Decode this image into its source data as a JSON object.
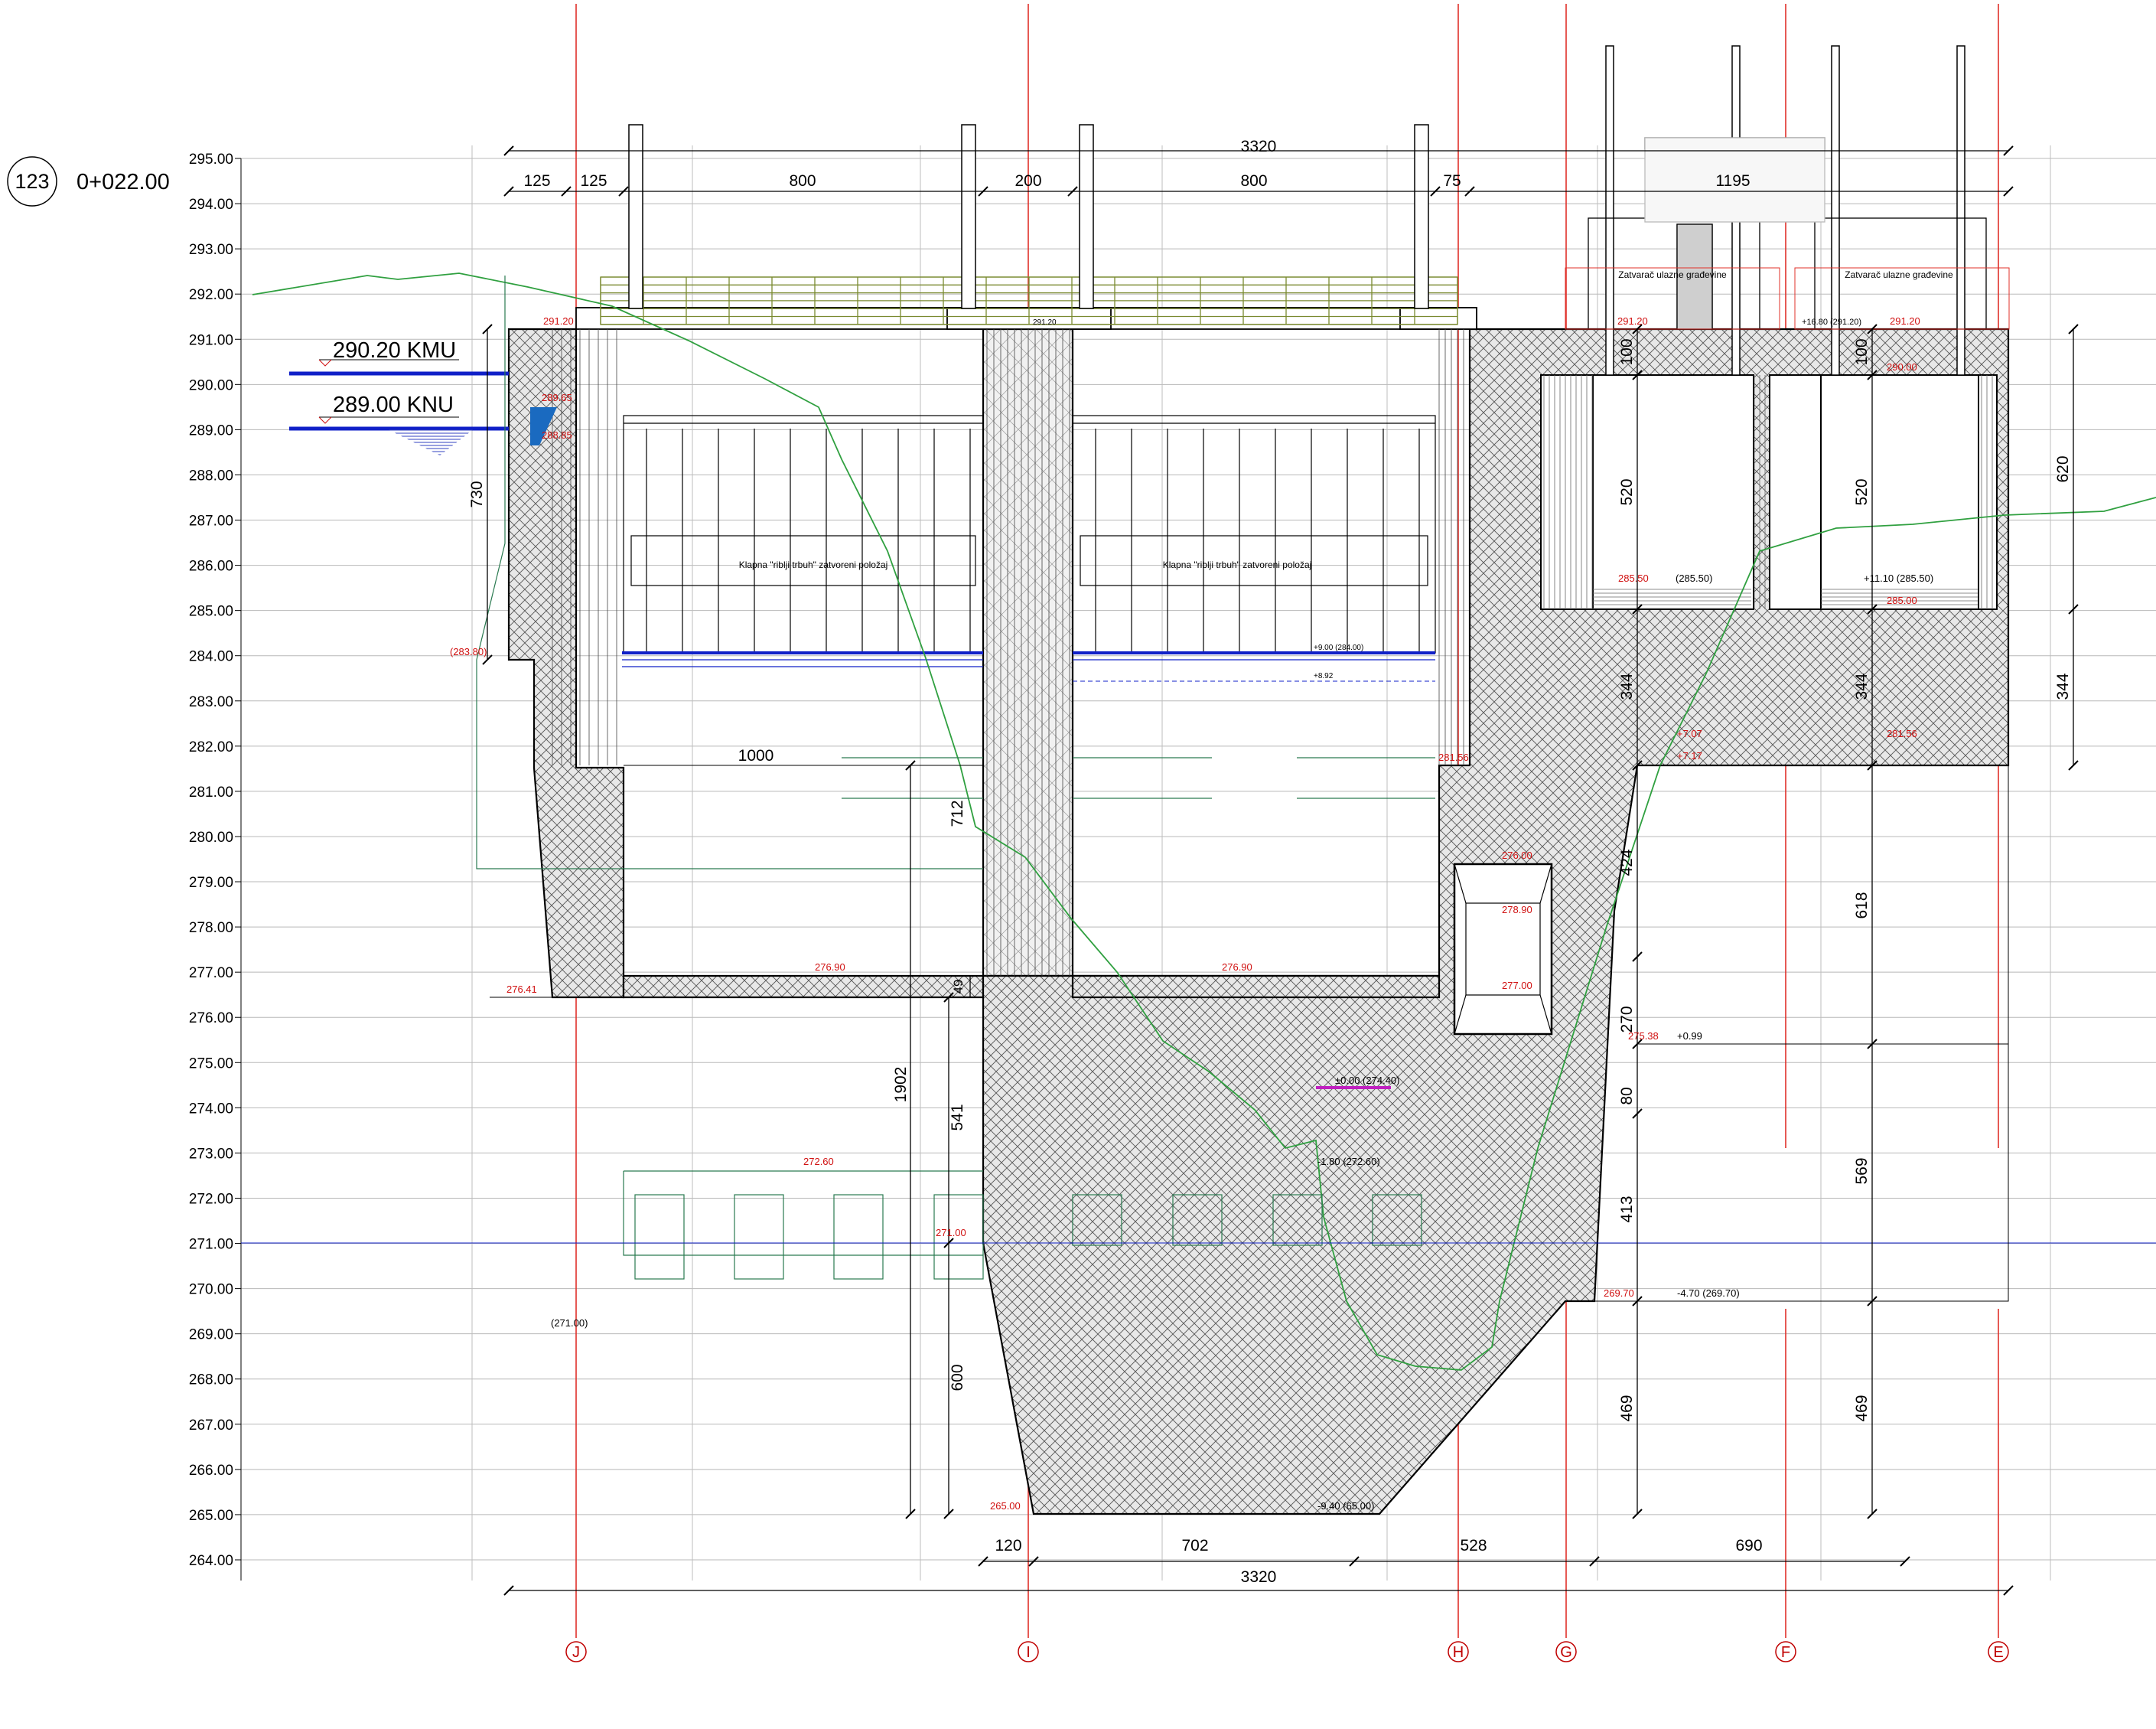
{
  "section": {
    "number": "123",
    "chainage": "0+022.00"
  },
  "elevation_scale": {
    "labels": [
      "295.00",
      "294.00",
      "293.00",
      "292.00",
      "291.00",
      "290.00",
      "289.00",
      "288.00",
      "287.00",
      "286.00",
      "285.00",
      "284.00",
      "283.00",
      "282.00",
      "281.00",
      "280.00",
      "279.00",
      "278.00",
      "277.00",
      "276.00",
      "275.00",
      "274.00",
      "273.00",
      "272.00",
      "271.00",
      "270.00",
      "269.00",
      "268.00",
      "267.00",
      "266.00",
      "265.00",
      "264.00"
    ]
  },
  "water_levels": {
    "kmu": "290.20 KMU",
    "knu": "289.00 KNU"
  },
  "dimensions_top": {
    "overall": "3320",
    "segments": [
      "125",
      "125",
      "800",
      "200",
      "800",
      "75",
      "1195"
    ]
  },
  "dimensions_bottom": {
    "overall": "3320",
    "segments": [
      "120",
      "702",
      "528",
      "690"
    ]
  },
  "dimensions_vertical": {
    "left_730": "730",
    "pier_712": "712",
    "pier_1902": "1902",
    "pier_541": "541",
    "pier_600": "600",
    "sill_49": "49",
    "right_620": "620",
    "right_344": "344",
    "g_100": "100",
    "g_520": "520",
    "g_344": "344",
    "g_424": "424",
    "g_270": "270",
    "g_80": "80",
    "g_413": "413",
    "g_469": "469",
    "f_100": "100",
    "f_520": "520",
    "f_344": "344",
    "f_618": "618",
    "f_569": "569",
    "f_469": "469",
    "span_1000": "1000"
  },
  "annotations": {
    "flap_left": "Klapna \"riblji trbuh\" zatvoreni položaj",
    "flap_right": "Klapna \"riblji trbuh\" zatvoreni položaj",
    "gate_left": "Zatvarač ulazne građevine",
    "gate_right": "Zatvarač ulazne građevine"
  },
  "level_marks": {
    "m1": "291.20",
    "m2": "291.20",
    "m3": "291.20",
    "m4": "291.20",
    "m5": "(283.80)",
    "m6": "276.41",
    "m7": "276.90",
    "m8": "276.90",
    "m9": "272.60",
    "m10": "271.00",
    "m11": "(271.00)",
    "m12": "265.00",
    "m13": "-9.40 (65.00)",
    "m14": "±0.00 (274.40)",
    "m15": "-1.80 (272.60)",
    "m16": "285.50",
    "m17": "(285.50)",
    "m18": "275.38",
    "m19": "+0.99",
    "m20": "269.70",
    "m21": "-4.70 (269.70)",
    "m22": "+7.07",
    "m23": "+7.17",
    "m24": "281.56",
    "m25": "+11.10 (285.50)",
    "m26": "+16.80 (291.20)",
    "m27": "281.56",
    "m28": "276.00",
    "m29": "278.90",
    "m30": "277.00",
    "m31": "289.65",
    "m32": "288.85",
    "m33": "+9.00 (284.00)",
    "m34": "+8.92",
    "m35": "285.00",
    "m36": "290.00"
  },
  "grid_axes": [
    "J",
    "I",
    "H",
    "G",
    "F",
    "E"
  ],
  "colors": {
    "axis_red": "#e0302a",
    "water_blue": "#1020c8",
    "terrain_green": "#30a040",
    "hatch": "#444444",
    "grating": "#7a8a30",
    "magenta": "#c020c0"
  }
}
